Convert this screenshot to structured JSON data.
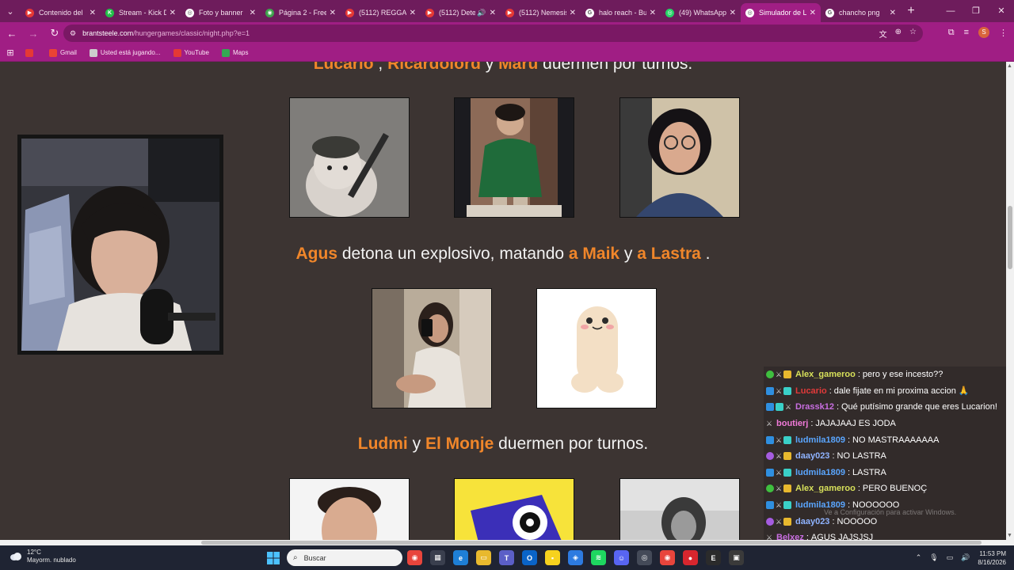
{
  "browser": {
    "tabs": [
      {
        "title": "Contenido del",
        "fav_color": "#e53935",
        "fav_glyph": "▶"
      },
      {
        "title": "Stream - Kick D",
        "fav_color": "#23c14a",
        "fav_glyph": "K"
      },
      {
        "title": "Foto y banner",
        "fav_color": "#ffffff",
        "fav_glyph": "◎"
      },
      {
        "title": "Página 2 - Free",
        "fav_color": "#3fa34d",
        "fav_glyph": "◉"
      },
      {
        "title": "(5112) REGGAE",
        "fav_color": "#e53935",
        "fav_glyph": "▶"
      },
      {
        "title": "(5112) Dete",
        "fav_color": "#e53935",
        "fav_glyph": "▶"
      },
      {
        "title": "(5112) Nemesis",
        "fav_color": "#e53935",
        "fav_glyph": "▶"
      },
      {
        "title": "halo reach - Bu",
        "fav_color": "#ffffff",
        "fav_glyph": "G"
      },
      {
        "title": "(49) WhatsApp",
        "fav_color": "#25d366",
        "fav_glyph": "◎"
      },
      {
        "title": "Simulador de L",
        "fav_color": "#ffffff",
        "fav_glyph": "◎"
      },
      {
        "title": "chancho png",
        "fav_color": "#ffffff",
        "fav_glyph": "G"
      }
    ],
    "url_host": "brantsteele.com",
    "url_path": "/hungergames/classic/night.php?e=1",
    "bookmarks": [
      {
        "label": "",
        "color": "#e53935"
      },
      {
        "label": "Gmail",
        "color": "#ea4335"
      },
      {
        "label": "Usted está jugando...",
        "color": "#cccccc"
      },
      {
        "label": "YouTube",
        "color": "#e53935"
      },
      {
        "label": "Maps",
        "color": "#34a853"
      }
    ]
  },
  "events": [
    {
      "parts": [
        {
          "t": "Lucario",
          "n": true
        },
        {
          "t": " , ",
          "n": false
        },
        {
          "t": "Ricardolord",
          "n": true
        },
        {
          "t": " y ",
          "n": false
        },
        {
          "t": "Maru",
          "n": true
        },
        {
          "t": " duermen por turnos.",
          "n": false
        }
      ]
    },
    {
      "parts": [
        {
          "t": "Agus",
          "n": true
        },
        {
          "t": " detona un explosivo, matando ",
          "n": false
        },
        {
          "t": "a Maik",
          "n": true
        },
        {
          "t": " y ",
          "n": false
        },
        {
          "t": "a Lastra",
          "n": true
        },
        {
          "t": " .",
          "n": false
        }
      ]
    },
    {
      "parts": [
        {
          "t": "Ludmi",
          "n": true
        },
        {
          "t": " y ",
          "n": false
        },
        {
          "t": "El Monje",
          "n": true
        },
        {
          "t": " duermen por turnos.",
          "n": false
        }
      ]
    }
  ],
  "chat": [
    {
      "badges": [
        "green",
        "sword",
        "gold"
      ],
      "user": "Alex_gameroo",
      "color": "#d7e05a",
      "text": "pero y ese incesto??"
    },
    {
      "badges": [
        "blue",
        "sword",
        "teal"
      ],
      "user": "Lucario",
      "color": "#e23a3a",
      "text": "dale fijate en mi proxima accion 🙏"
    },
    {
      "badges": [
        "blue",
        "teal",
        "sword"
      ],
      "user": "Drassk12",
      "color": "#c86ee0",
      "text": "Qué putísimo grande que eres Lucarion!"
    },
    {
      "badges": [
        "sword"
      ],
      "user": "boutierj",
      "color": "#f07ad8",
      "text": "JAJAJAAJ ES JODA"
    },
    {
      "badges": [
        "blue",
        "sword",
        "teal"
      ],
      "user": "ludmila1809",
      "color": "#5aa6ff",
      "text": "NO MASTRAAAAAAA"
    },
    {
      "badges": [
        "purple",
        "sword",
        "gold"
      ],
      "user": "daay023",
      "color": "#8fb3ff",
      "text": "NO LASTRA"
    },
    {
      "badges": [
        "blue",
        "sword",
        "teal"
      ],
      "user": "ludmila1809",
      "color": "#5aa6ff",
      "text": "LASTRA"
    },
    {
      "badges": [
        "green",
        "sword",
        "gold"
      ],
      "user": "Alex_gameroo",
      "color": "#d7e05a",
      "text": "PERO BUENOÇ"
    },
    {
      "badges": [
        "blue",
        "sword",
        "teal"
      ],
      "user": "ludmila1809",
      "color": "#5aa6ff",
      "text": "NOOOOOO"
    },
    {
      "badges": [
        "purple",
        "sword",
        "gold"
      ],
      "user": "daay023",
      "color": "#8fb3ff",
      "text": "NOOOOO"
    },
    {
      "badges": [
        "sword"
      ],
      "user": "Belxez",
      "color": "#c86ee0",
      "text": "AGUS JAJSJSJ"
    }
  ],
  "watermark": "Ve a Configuración para activar Windows.",
  "taskbar": {
    "temp": "12°C",
    "weather": "Mayorm. nublado",
    "search": "Buscar",
    "time": "11:53 PM",
    "date": "8/16/2026"
  },
  "colors": {
    "accent": "#a01e84",
    "name": "#f0862a",
    "bg": "#3c3432"
  }
}
